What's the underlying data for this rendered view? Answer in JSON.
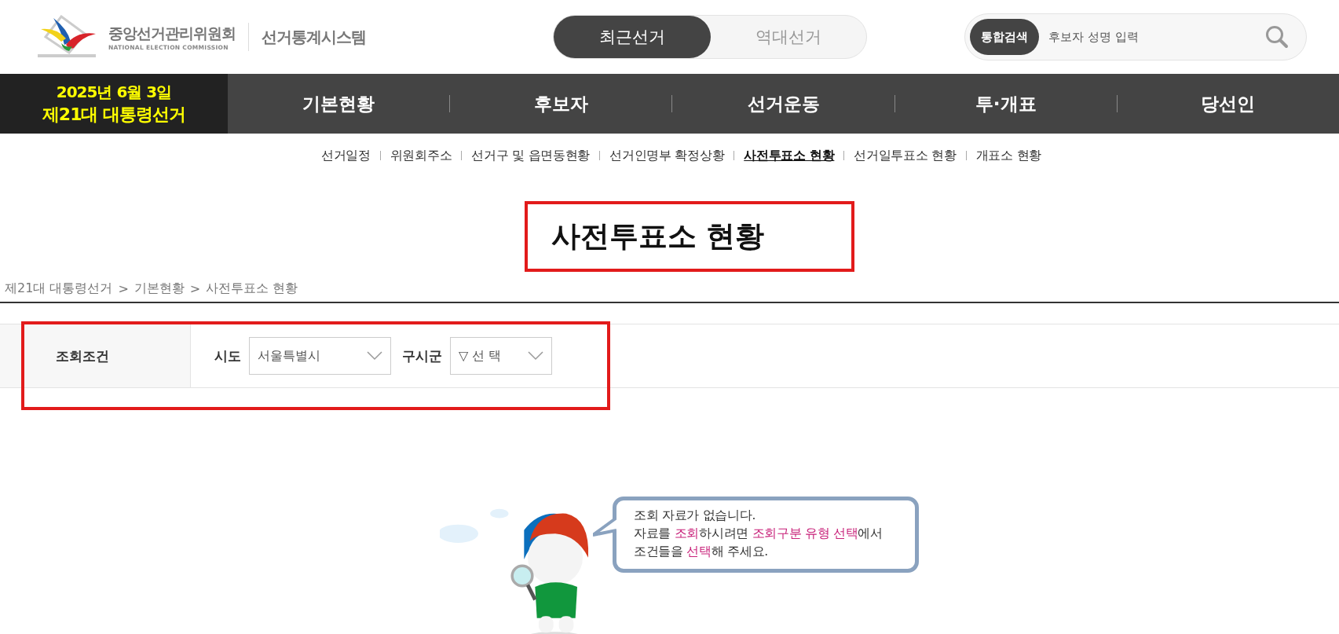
{
  "header": {
    "org_name": "중앙선거관리위원회",
    "org_name_en": "NATIONAL ELECTION COMMISSION",
    "system_name": "선거통계시스템",
    "tabs": [
      {
        "label": "최근선거",
        "selected": true
      },
      {
        "label": "역대선거",
        "selected": false
      }
    ],
    "search": {
      "button": "통합검색",
      "placeholder": "후보자 성명 입력"
    }
  },
  "election": {
    "date": "2025년 6월 3일",
    "name": "제21대 대통령선거"
  },
  "nav": [
    "기본현황",
    "후보자",
    "선거운동",
    "투·개표",
    "당선인"
  ],
  "submenu": [
    {
      "label": "선거일정",
      "selected": false
    },
    {
      "label": "위원회주소",
      "selected": false
    },
    {
      "label": "선거구 및 읍면동현황",
      "selected": false
    },
    {
      "label": "선거인명부 확정상황",
      "selected": false
    },
    {
      "label": "사전투표소 현황",
      "selected": true
    },
    {
      "label": "선거일투표소 현황",
      "selected": false
    },
    {
      "label": "개표소 현황",
      "selected": false
    }
  ],
  "page_title": {
    "text": "사전투표소 현황",
    "highlighted": true
  },
  "breadcrumb": [
    "제21대 대통령선거",
    "기본현황",
    "사전투표소 현황"
  ],
  "breadcrumb_separator": ">",
  "filter": {
    "highlighted": true,
    "label": "조회조건",
    "fields": [
      {
        "label": "시도",
        "value": "서울특별시"
      },
      {
        "label": "구시군",
        "value": "▽ 선 택"
      }
    ]
  },
  "empty_message": {
    "lines": [
      [
        {
          "text": "조회 자료가 없습니다.",
          "emphasis": false
        }
      ],
      [
        {
          "text": "자료를 ",
          "emphasis": false
        },
        {
          "text": "조회",
          "emphasis": true
        },
        {
          "text": "하시려면 ",
          "emphasis": false
        },
        {
          "text": "조회구분 유형 선택",
          "emphasis": true
        },
        {
          "text": "에서",
          "emphasis": false
        }
      ],
      [
        {
          "text": "조건들을 ",
          "emphasis": false
        },
        {
          "text": "선택",
          "emphasis": true
        },
        {
          "text": "해 주세요.",
          "emphasis": false
        }
      ]
    ]
  }
}
